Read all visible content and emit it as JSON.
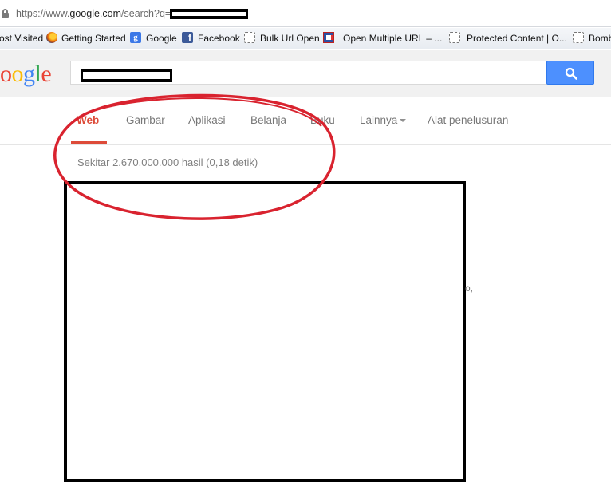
{
  "browser": {
    "url_scheme": "https://www.",
    "url_host": "google.com",
    "url_path": "/search?q="
  },
  "bookmarks": [
    {
      "label": "ost Visited",
      "icon": "none"
    },
    {
      "label": "Getting Started",
      "icon": "firefox-icon"
    },
    {
      "label": "Google",
      "icon": "google-plus-icon"
    },
    {
      "label": "Facebook",
      "icon": "facebook-icon"
    },
    {
      "label": "Bulk Url Open",
      "icon": "page-icon"
    },
    {
      "label": "Open Multiple URL – ...",
      "icon": "multi-url-icon"
    },
    {
      "label": "Protected Content | O...",
      "icon": "page-icon"
    },
    {
      "label": "Bomb",
      "icon": "page-icon"
    }
  ],
  "header": {
    "logo_text": "oogle",
    "search_icon": "search-icon"
  },
  "tabs": [
    {
      "label": "Web",
      "active": true
    },
    {
      "label": "Gambar"
    },
    {
      "label": "Aplikasi"
    },
    {
      "label": "Belanja"
    },
    {
      "label": "Buku"
    },
    {
      "label": "Lainnya"
    },
    {
      "label": "Alat penelusuran"
    }
  ],
  "result_stats": "Sekitar 2.670.000.000 hasil (0,18 detik)",
  "stray_text": "o,",
  "colors": {
    "active_tab": "#dd4b39",
    "search_button": "#4d90fe",
    "annotation": "#d9232f"
  }
}
